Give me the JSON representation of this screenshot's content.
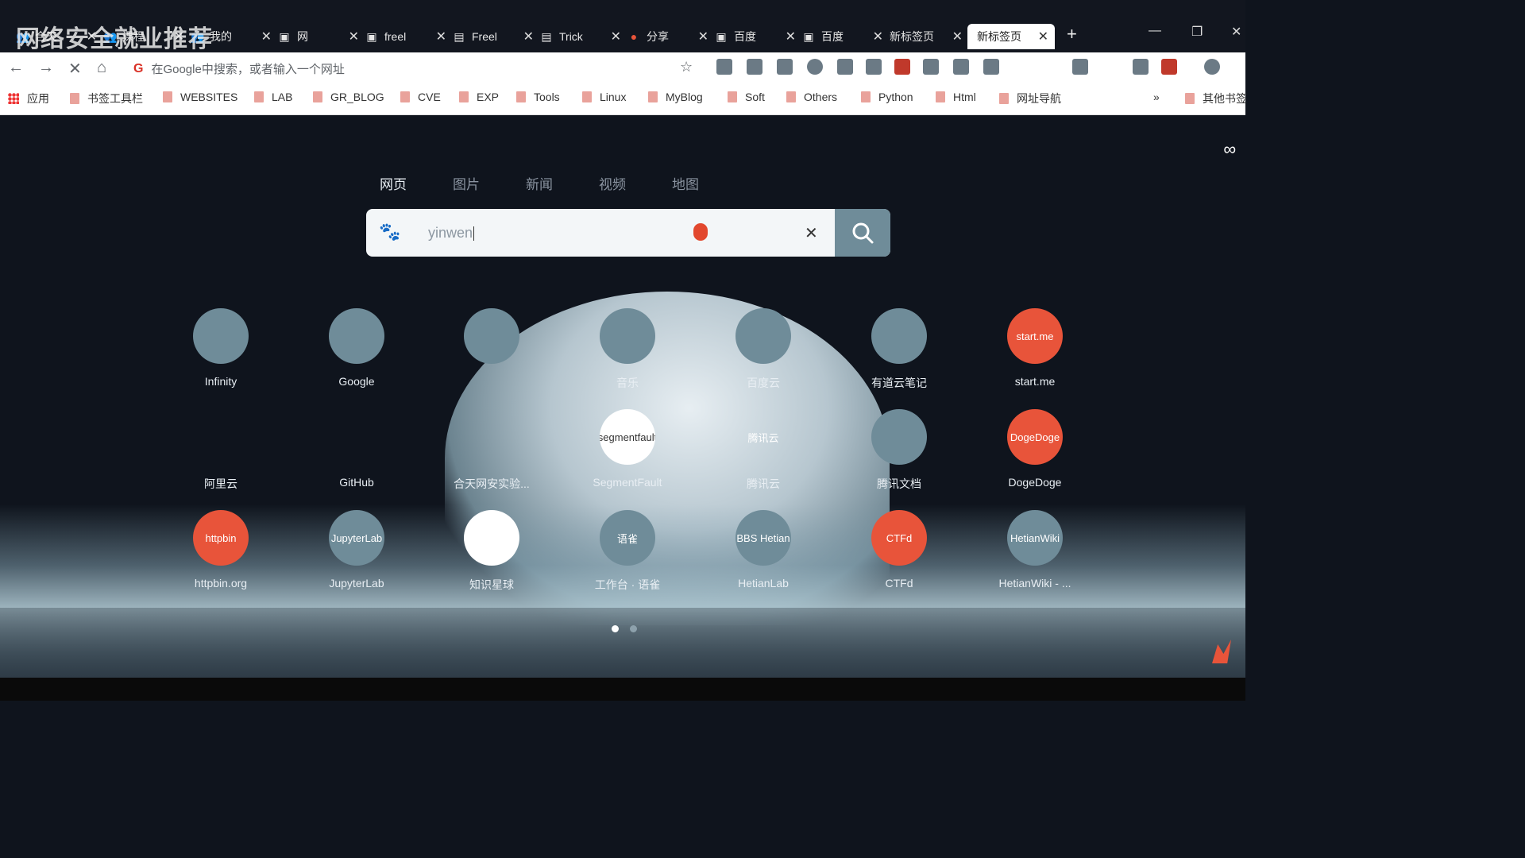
{
  "watermark": "网络安全就业推荐",
  "tabs": [
    {
      "title": "合天",
      "icon": "people-icon"
    },
    {
      "title": "课程",
      "icon": "people-icon"
    },
    {
      "title": "我的",
      "icon": "people-icon"
    },
    {
      "title": "网",
      "icon": "page-icon"
    },
    {
      "title": "freel",
      "icon": "page-icon"
    },
    {
      "title": "Freel",
      "icon": "page-icon"
    },
    {
      "title": "Trick",
      "icon": "page-icon"
    },
    {
      "title": "分享",
      "icon": "weibo-icon"
    },
    {
      "title": "百度",
      "icon": "page-icon"
    },
    {
      "title": "百度",
      "icon": "page-icon"
    },
    {
      "title": "新标签页",
      "icon": ""
    },
    {
      "title": "新标签页",
      "icon": "",
      "active": true
    }
  ],
  "omnibox": {
    "placeholder": "在Google中搜索，或者输入一个网址"
  },
  "bookmarks": [
    "应用",
    "书签工具栏",
    "WEBSITES",
    "LAB",
    "GR_BLOG",
    "CVE",
    "EXP",
    "Tools",
    "Linux",
    "MyBlog",
    "Soft",
    "Others",
    "Python",
    "Html",
    "网址导航",
    "»",
    "其他书签"
  ],
  "search_tabs": [
    "网页",
    "图片",
    "新闻",
    "视频",
    "地图"
  ],
  "search": {
    "query": "yinwen"
  },
  "tiles": [
    {
      "label": "Infinity",
      "icon_text": "",
      "color": "#6f8c99"
    },
    {
      "label": "Google",
      "icon_text": "",
      "color": "#6f8c99"
    },
    {
      "label": "",
      "icon_text": "",
      "color": "#6f8c99"
    },
    {
      "label": "音乐",
      "icon_text": "",
      "color": "#6f8c99"
    },
    {
      "label": "百度云",
      "icon_text": "",
      "color": "#6f8c99"
    },
    {
      "label": "有道云笔记",
      "icon_text": "",
      "color": "#6f8c99"
    },
    {
      "label": "start.me",
      "icon_text": "start.me",
      "color": "#e8543a"
    },
    {
      "label": "阿里云",
      "icon_text": "",
      "color": "transparent"
    },
    {
      "label": "GitHub",
      "icon_text": "",
      "color": "transparent"
    },
    {
      "label": "合天网安实验...",
      "icon_text": "",
      "color": "transparent"
    },
    {
      "label": "SegmentFault",
      "icon_text": "segmentfault",
      "color": "#ffffff"
    },
    {
      "label": "腾讯云",
      "icon_text": "腾讯云",
      "color": "transparent"
    },
    {
      "label": "腾讯文档",
      "icon_text": "",
      "color": "#6f8c99"
    },
    {
      "label": "DogeDoge",
      "icon_text": "DogeDoge",
      "color": "#e8543a"
    },
    {
      "label": "httpbin.org",
      "icon_text": "httpbin",
      "color": "#e8543a"
    },
    {
      "label": "JupyterLab",
      "icon_text": "JupyterLab",
      "color": "#6f8c99"
    },
    {
      "label": "知识星球",
      "icon_text": "",
      "color": "#ffffff"
    },
    {
      "label": "工作台 · 语雀",
      "icon_text": "语雀",
      "color": "#6f8c99"
    },
    {
      "label": "HetianLab",
      "icon_text": "BBS Hetian",
      "color": "#6f8c99"
    },
    {
      "label": "CTFd",
      "icon_text": "CTFd",
      "color": "#e8543a"
    },
    {
      "label": "HetianWiki - ...",
      "icon_text": "HetianWiki",
      "color": "#6f8c99"
    }
  ],
  "colors": {
    "accent": "#6f8c99",
    "brand_red": "#e8543a",
    "bg": "#0f141d"
  }
}
